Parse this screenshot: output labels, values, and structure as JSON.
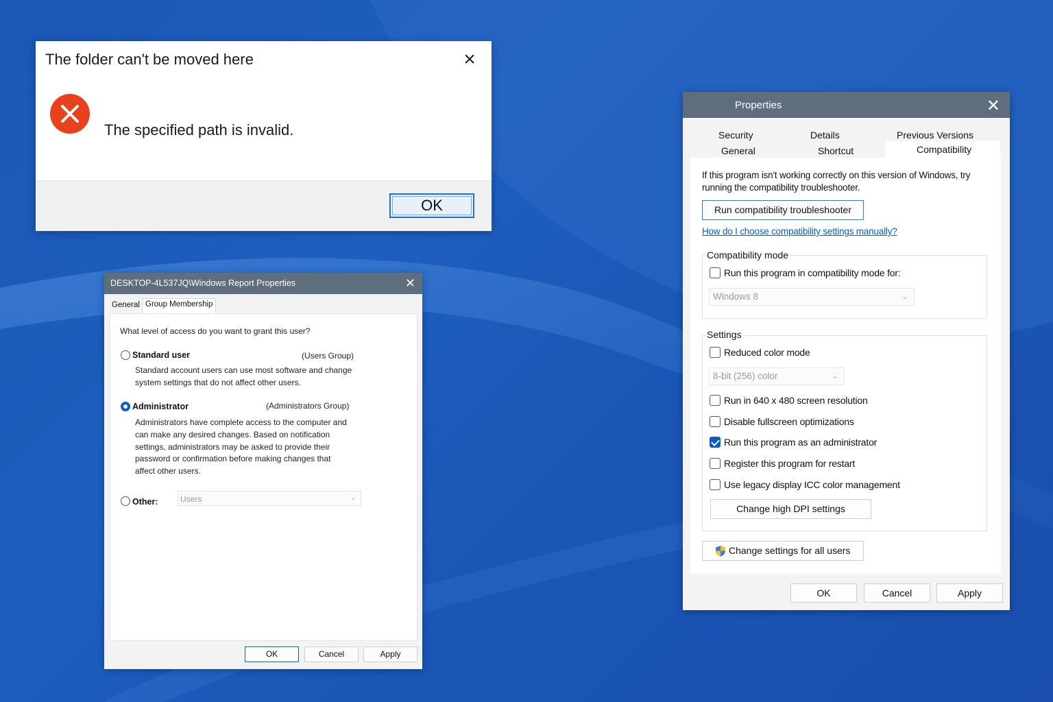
{
  "error_dialog": {
    "title": "The folder can't be moved here",
    "message": "The specified path is invalid.",
    "ok_label": "OK",
    "icon": "error-x-icon",
    "icon_color": "#e8411e"
  },
  "user_properties": {
    "title": "DESKTOP-4L537JQ\\Windows Report Properties",
    "tabs": [
      {
        "label": "General"
      },
      {
        "label": "Group Membership",
        "active": true
      }
    ],
    "question": "What level of access do you want to grant this user?",
    "options": {
      "standard": {
        "label": "Standard user",
        "group": "(Users Group)",
        "desc": [
          "Standard account users can use most software and change",
          "system settings that do not affect other users."
        ],
        "selected": false
      },
      "admin": {
        "label": "Administrator",
        "group": "(Administrators Group)",
        "desc": [
          "Administrators have complete access to the computer and",
          "can make any desired changes. Based on notification",
          "settings, administrators may be asked to provide their",
          "password or confirmation before making changes that",
          "affect other users."
        ],
        "selected": true
      },
      "other": {
        "label": "Other:",
        "select_value": "Users",
        "selected": false
      }
    },
    "buttons": {
      "ok": "OK",
      "cancel": "Cancel",
      "apply": "Apply"
    }
  },
  "program_properties": {
    "title": "Properties",
    "tabs_row1": [
      {
        "label": "Security"
      },
      {
        "label": "Details"
      },
      {
        "label": "Previous Versions"
      }
    ],
    "tabs_row2": [
      {
        "label": "General"
      },
      {
        "label": "Shortcut"
      },
      {
        "label": "Compatibility",
        "active": true
      }
    ],
    "intro": "If this program isn't working correctly on this version of Windows, try running the compatibility troubleshooter.",
    "run_troubleshooter": "Run compatibility troubleshooter",
    "manual_link": "How do I choose compatibility settings manually?",
    "compat_mode": {
      "label": "Compatibility mode",
      "checkbox_label": "Run this program in compatibility mode for:",
      "checked": false,
      "select_value": "Windows 8"
    },
    "settings": {
      "label": "Settings",
      "reduced_color": {
        "label": "Reduced color mode",
        "checked": false
      },
      "color_select_value": "8-bit (256) color",
      "res_640": {
        "label": "Run in 640 x 480 screen resolution",
        "checked": false
      },
      "disable_fullscreen": {
        "label": "Disable fullscreen optimizations",
        "checked": false
      },
      "run_admin": {
        "label": "Run this program as an administrator",
        "checked": true
      },
      "register_restart": {
        "label": "Register this program for restart",
        "checked": false
      },
      "legacy_icc": {
        "label": "Use legacy display ICC color management",
        "checked": false
      },
      "dpi_button": "Change high DPI settings"
    },
    "all_users_button": "Change settings for all users",
    "buttons": {
      "ok": "OK",
      "cancel": "Cancel",
      "apply": "Apply"
    }
  },
  "colors": {
    "desktop_blue": "#1b57b4",
    "titlebar_gray": "#5e6e7d",
    "accent_blue": "#0b5cc2",
    "error_red": "#e8411e"
  }
}
